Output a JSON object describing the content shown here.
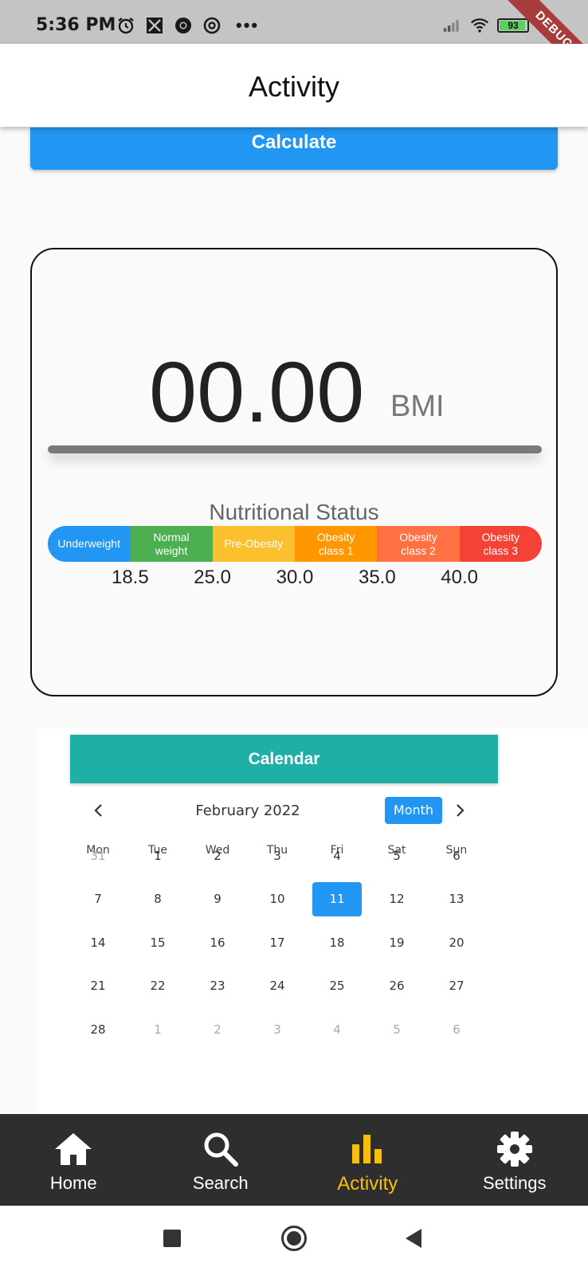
{
  "status_bar": {
    "time": "5:36 PM",
    "left_icons": [
      "alarm-icon",
      "mail-icon",
      "chrome-icon",
      "at-icon"
    ],
    "more": "•••",
    "battery": "93",
    "debug_banner": "DEBUG"
  },
  "app_bar": {
    "title": "Activity"
  },
  "calculate_button": {
    "label": "Calculate"
  },
  "bmi_card": {
    "value": "00.00",
    "unit": "BMI",
    "nutritional_status_title": "Nutritional Status",
    "categories": [
      {
        "label_line1": "Underweight",
        "label_line2": "",
        "color": "#2196f3"
      },
      {
        "label_line1": "Normal",
        "label_line2": "weight",
        "color": "#4caf50"
      },
      {
        "label_line1": "Pre-Obesity",
        "label_line2": "",
        "color": "#fbc02d"
      },
      {
        "label_line1": "Obesity",
        "label_line2": "class 1",
        "color": "#ff9800"
      },
      {
        "label_line1": "Obesity",
        "label_line2": "class 2",
        "color": "#ff7043"
      },
      {
        "label_line1": "Obesity",
        "label_line2": "class 3",
        "color": "#f44336"
      }
    ],
    "thresholds": [
      "18.5",
      "25.0",
      "30.0",
      "35.0",
      "40.0"
    ]
  },
  "calendar": {
    "header": "Calendar",
    "month_label": "February 2022",
    "view_button": "Month",
    "weekdays": [
      "Mon",
      "Tue",
      "Wed",
      "Thu",
      "Fri",
      "Sat",
      "Sun"
    ],
    "weeks": [
      [
        {
          "d": "31",
          "muted": true
        },
        {
          "d": "1"
        },
        {
          "d": "2"
        },
        {
          "d": "3"
        },
        {
          "d": "4"
        },
        {
          "d": "5"
        },
        {
          "d": "6"
        }
      ],
      [
        {
          "d": "7"
        },
        {
          "d": "8"
        },
        {
          "d": "9"
        },
        {
          "d": "10"
        },
        {
          "d": "11",
          "selected": true
        },
        {
          "d": "12"
        },
        {
          "d": "13"
        }
      ],
      [
        {
          "d": "14"
        },
        {
          "d": "15"
        },
        {
          "d": "16"
        },
        {
          "d": "17"
        },
        {
          "d": "18"
        },
        {
          "d": "19"
        },
        {
          "d": "20"
        }
      ],
      [
        {
          "d": "21"
        },
        {
          "d": "22"
        },
        {
          "d": "23"
        },
        {
          "d": "24"
        },
        {
          "d": "25"
        },
        {
          "d": "26"
        },
        {
          "d": "27"
        }
      ],
      [
        {
          "d": "28"
        },
        {
          "d": "1",
          "muted": true
        },
        {
          "d": "2",
          "muted": true
        },
        {
          "d": "3",
          "muted": true
        },
        {
          "d": "4",
          "muted": true
        },
        {
          "d": "5",
          "muted": true
        },
        {
          "d": "6",
          "muted": true
        }
      ]
    ],
    "selected_date": "11"
  },
  "bottom_nav": {
    "items": [
      {
        "label": "Home",
        "icon": "home-icon"
      },
      {
        "label": "Search",
        "icon": "search-icon"
      },
      {
        "label": "Activity",
        "icon": "bar-chart-icon",
        "active": true
      },
      {
        "label": "Settings",
        "icon": "gear-icon"
      }
    ],
    "active_color": "#f6bf10"
  },
  "system_nav": {
    "buttons": [
      "recents-icon",
      "home-circle-icon",
      "back-icon"
    ]
  }
}
